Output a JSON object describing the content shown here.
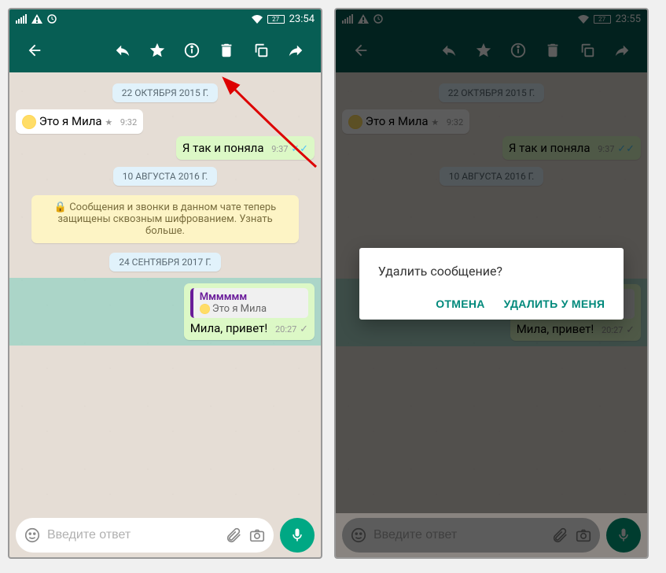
{
  "status": {
    "battery": "27",
    "time_left": "23:54",
    "time_right": "23:55"
  },
  "toolbar": {
    "back": "←",
    "reply": "reply",
    "star": "star",
    "info": "info",
    "delete": "delete",
    "copy": "copy",
    "forward": "forward"
  },
  "dates": {
    "d1": "22 ОКТЯБРЯ 2015 Г.",
    "d2": "10 АВГУСТА 2016 Г.",
    "d3": "24 СЕНТЯБРЯ 2017 Г."
  },
  "messages": {
    "m1_text": "Это я Мила",
    "m1_time": "9:32",
    "m2_text": "Я так и поняла",
    "m2_time": "9:37",
    "enc": "Сообщения и звонки в данном чате теперь защищены сквозным шифрованием. Узнать больше.",
    "reply_name": "Мммммм",
    "reply_text": "Это я Мила",
    "m3_text": "Мила, привет!",
    "m3_time": "20:27"
  },
  "input": {
    "placeholder": "Введите ответ"
  },
  "dialog": {
    "title": "Удалить сообщение?",
    "cancel": "ОТМЕНА",
    "delete_for_me": "УДАЛИТЬ У МЕНЯ"
  }
}
